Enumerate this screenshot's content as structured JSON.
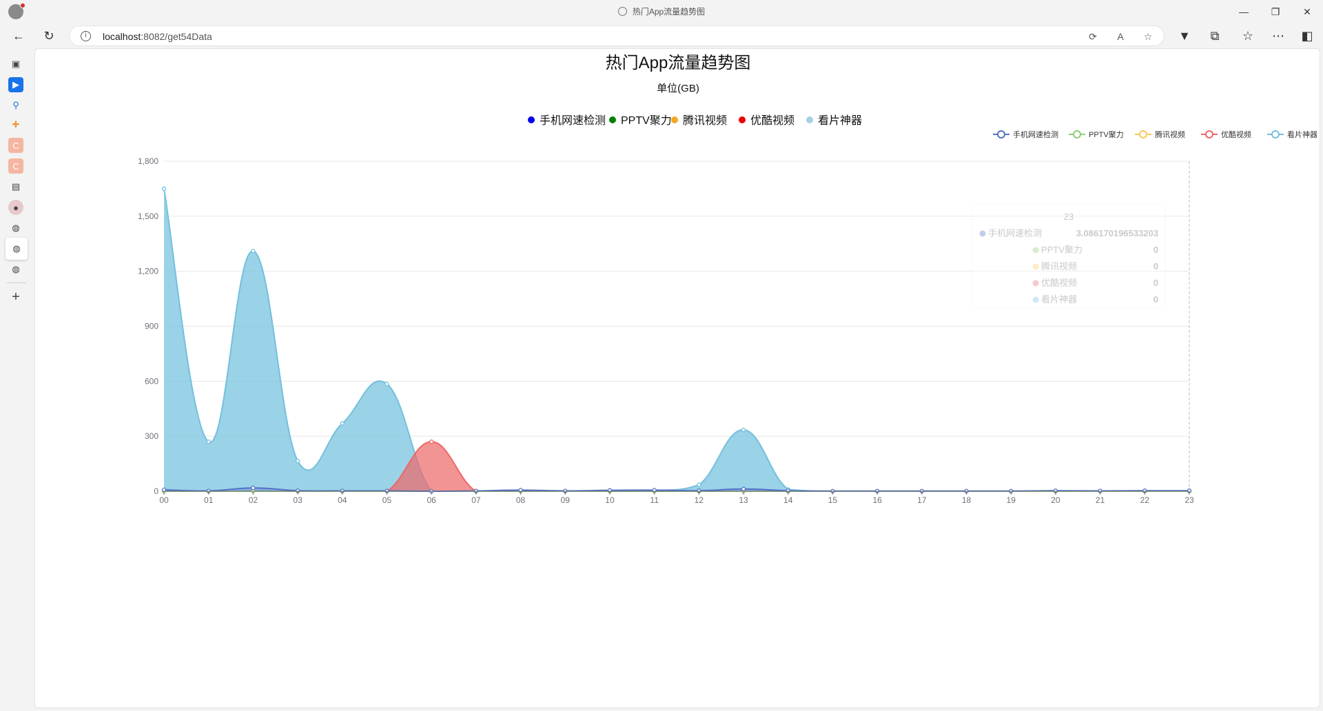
{
  "window": {
    "title": "热门App流量趋势图",
    "controls": {
      "minimize": "—",
      "restore": "❐",
      "close": "✕"
    }
  },
  "toolbar": {
    "url_host": "localhost",
    "url_path": ":8082/get54Data"
  },
  "sidebar": {
    "items": [
      "collections-icon",
      "app-icon",
      "search-icon",
      "puzzle-icon",
      "c-app-icon",
      "c-app-icon-2",
      "doc-icon",
      "avatar-icon",
      "globe-icon",
      "globe-icon-active",
      "globe-icon-2",
      "add-icon"
    ]
  },
  "chart_data": {
    "type": "area",
    "title": "热门App流量趋势图",
    "subtitle": "单位(GB)",
    "x": [
      "00",
      "01",
      "02",
      "03",
      "04",
      "05",
      "06",
      "07",
      "08",
      "09",
      "10",
      "11",
      "12",
      "13",
      "14",
      "15",
      "16",
      "17",
      "18",
      "19",
      "20",
      "21",
      "22",
      "23"
    ],
    "ylim": [
      0,
      1800
    ],
    "yticks": [
      0,
      300,
      600,
      900,
      1200,
      1500,
      1800
    ],
    "ytick_labels": [
      "0",
      "300",
      "600",
      "900",
      "1,200",
      "1,500",
      "1,800"
    ],
    "grid": true,
    "legend_top": [
      "手机网速检测",
      "PPTV聚力",
      "腾讯视频",
      "优酷视频",
      "看片神器"
    ],
    "legend_right": [
      "手机网速检测",
      "PPTV聚力",
      "腾讯视频",
      "优酷视频",
      "看片神器"
    ],
    "series": [
      {
        "name": "手机网速检测",
        "color": "#5470c6",
        "dot_color": "#0000ee",
        "values": [
          8,
          2,
          18,
          3,
          2,
          2,
          0,
          2,
          6,
          2,
          5,
          6,
          3,
          12,
          3,
          1,
          1,
          1,
          1,
          1,
          3,
          2,
          3,
          3
        ]
      },
      {
        "name": "PPTV聚力",
        "color": "#91cc75",
        "dot_color": "#008000",
        "values": [
          0,
          0,
          0,
          0,
          0,
          0,
          0,
          0,
          0,
          0,
          0,
          0,
          0,
          0,
          0,
          0,
          0,
          0,
          0,
          0,
          0,
          0,
          0,
          0
        ]
      },
      {
        "name": "腾讯视频",
        "color": "#fac858",
        "dot_color": "#f5a623",
        "values": [
          0,
          0,
          0,
          0,
          0,
          0,
          0,
          0,
          0,
          0,
          0,
          0,
          0,
          0,
          0,
          0,
          0,
          0,
          0,
          0,
          0,
          0,
          0,
          0
        ]
      },
      {
        "name": "优酷视频",
        "color": "#ee6666",
        "dot_color": "#ee0000",
        "values": [
          0,
          0,
          0,
          0,
          0,
          0,
          270,
          0,
          0,
          0,
          0,
          0,
          0,
          0,
          0,
          0,
          0,
          0,
          0,
          0,
          0,
          0,
          0,
          0
        ]
      },
      {
        "name": "看片神器",
        "color": "#73c0de",
        "dot_color": "#a6cfe5",
        "values": [
          1650,
          270,
          1310,
          165,
          370,
          585,
          0,
          0,
          0,
          0,
          3,
          3,
          35,
          335,
          10,
          0,
          0,
          0,
          0,
          0,
          0,
          0,
          0,
          0
        ]
      }
    ],
    "tooltip": {
      "header": "23",
      "rows": [
        {
          "name": "手机网速检测",
          "value": "3.086170196533203"
        },
        {
          "name": "PPTV聚力",
          "value": "0"
        },
        {
          "name": "腾讯视频",
          "value": "0"
        },
        {
          "name": "优酷视频",
          "value": "0"
        },
        {
          "name": "看片神器",
          "value": "0"
        }
      ]
    }
  }
}
